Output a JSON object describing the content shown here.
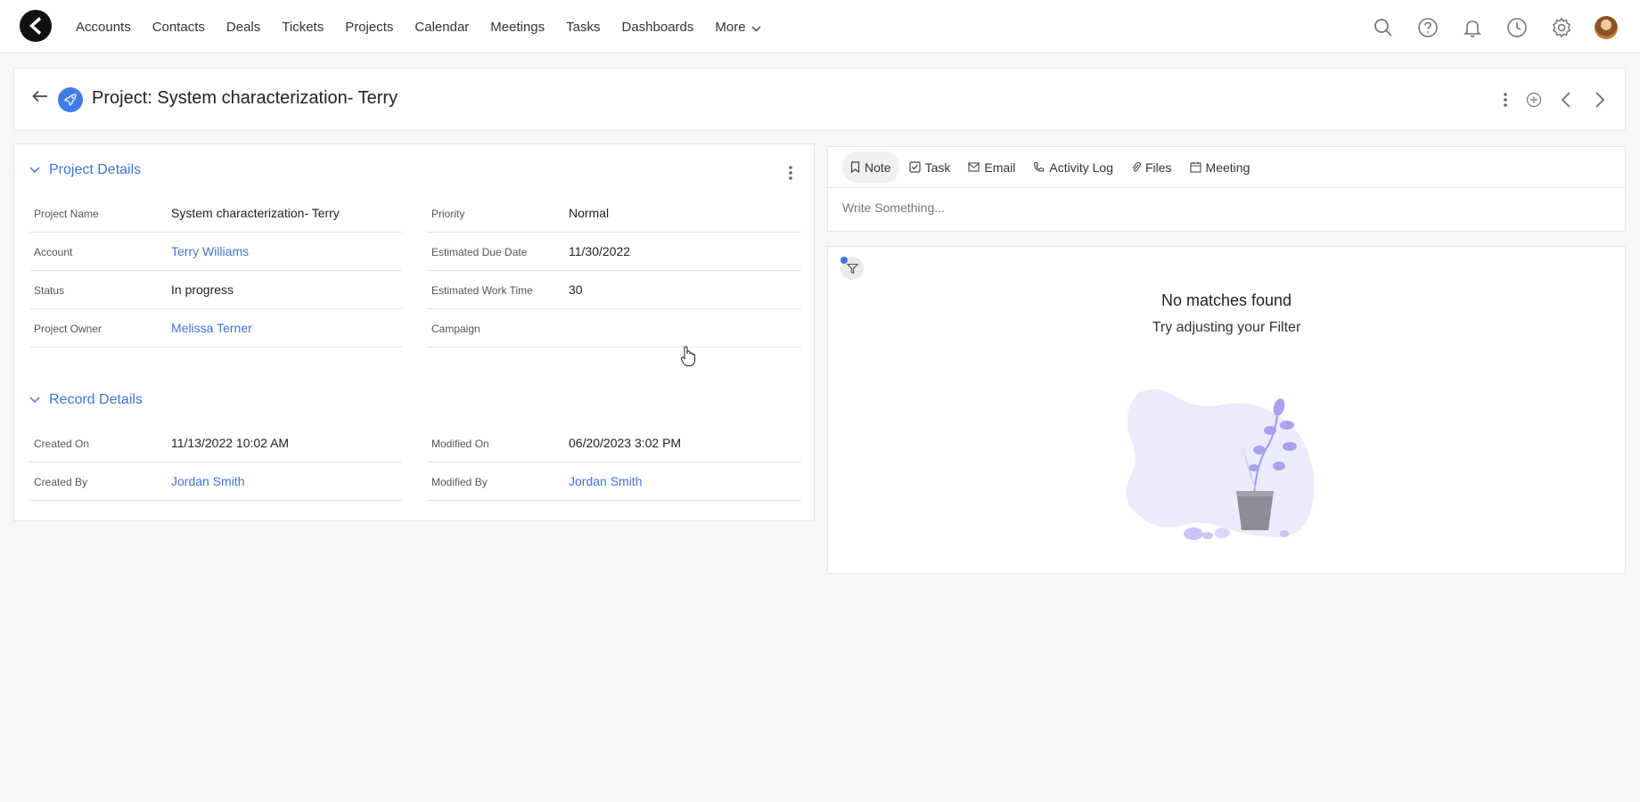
{
  "nav": {
    "items": [
      "Accounts",
      "Contacts",
      "Deals",
      "Tickets",
      "Projects",
      "Calendar",
      "Meetings",
      "Tasks",
      "Dashboards"
    ],
    "more_label": "More"
  },
  "header": {
    "title": "Project: System characterization- Terry"
  },
  "project_details": {
    "section_title": "Project Details",
    "rows": [
      {
        "label": "Project Name",
        "value": "System characterization- Terry"
      },
      {
        "label": "Priority",
        "value": "Normal"
      },
      {
        "label": "Account",
        "value": "Terry Williams"
      },
      {
        "label": "Estimated Due Date",
        "value": "11/30/2022"
      },
      {
        "label": "Status",
        "value": "In progress"
      },
      {
        "label": "Estimated Work Time",
        "value": "30"
      },
      {
        "label": "Project Owner",
        "value": "Melissa Terner"
      },
      {
        "label": "Campaign",
        "value": ""
      }
    ]
  },
  "record_details": {
    "section_title": "Record Details",
    "rows": [
      {
        "label": "Created On",
        "value": "11/13/2022 10:02 AM"
      },
      {
        "label": "Modified On",
        "value": "06/20/2023 3:02 PM"
      },
      {
        "label": "Created By",
        "value": "Jordan Smith"
      },
      {
        "label": "Modified By",
        "value": "Jordan Smith"
      }
    ]
  },
  "composer": {
    "tabs": [
      "Note",
      "Task",
      "Email",
      "Activity Log",
      "Files",
      "Meeting"
    ],
    "placeholder": "Write Something..."
  },
  "activity": {
    "empty_title": "No matches found",
    "empty_subtitle": "Try adjusting your Filter"
  },
  "colors": {
    "accent": "#3f74d8",
    "illustration": "#a8a2ec"
  }
}
